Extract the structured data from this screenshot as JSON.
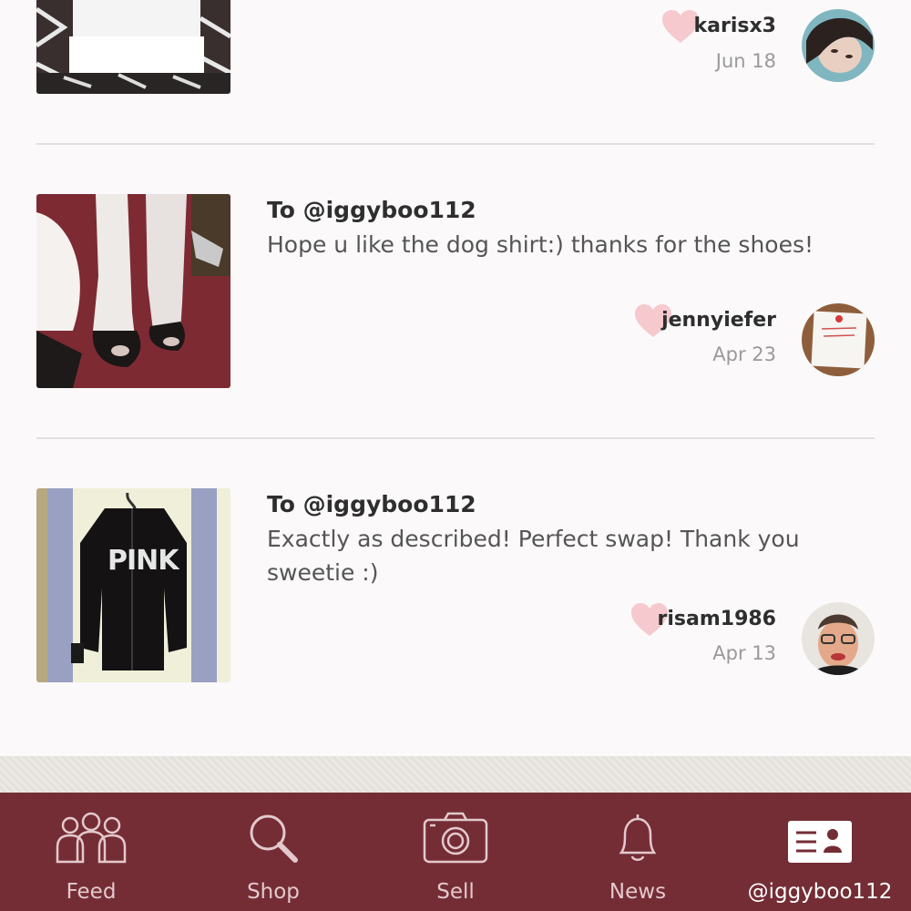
{
  "reviews": [
    {
      "to": "",
      "message": "",
      "user": "karisx3",
      "date": "Jun 18"
    },
    {
      "to": "To @iggyboo112",
      "message": "Hope u like the dog shirt:) thanks for the shoes!",
      "user": "jennyiefer",
      "date": "Apr 23"
    },
    {
      "to": "To @iggyboo112",
      "message": "Exactly as described! Perfect swap! Thank you sweetie :)",
      "user": "risam1986",
      "date": "Apr 13",
      "hoodie_text": "PINK"
    }
  ],
  "tabs": [
    {
      "label": "Feed",
      "icon": "people-icon"
    },
    {
      "label": "Shop",
      "icon": "search-icon"
    },
    {
      "label": "Sell",
      "icon": "camera-icon"
    },
    {
      "label": "News",
      "icon": "bell-icon"
    },
    {
      "label": "@iggyboo112",
      "icon": "profile-card-icon",
      "active": true
    }
  ],
  "colors": {
    "tabbar": "#742d35",
    "heart": "#f6c9cf",
    "background": "#fbf9fa"
  }
}
